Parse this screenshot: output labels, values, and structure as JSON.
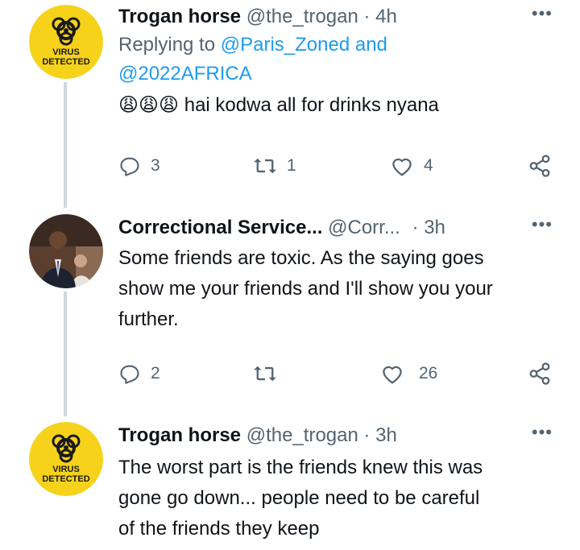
{
  "tweets": [
    {
      "author_name": "Trogan horse",
      "handle": "@the_trogan",
      "time": "4h",
      "replying_label": "Replying to",
      "replying_mentions": "@Paris_Zoned and",
      "replying_mentions2": "@2022AFRICA",
      "emoji": "😩😩😩",
      "text": "hai kodwa all for drinks nyana",
      "replies": "3",
      "retweets": "1",
      "likes": "4",
      "avatar_label_line1": "VIRUS",
      "avatar_label_line2": "DETECTED"
    },
    {
      "author_name": "Correctional Service...",
      "handle": "@Corr...",
      "time": "3h",
      "text_lines": [
        "Some friends are toxic. As the saying goes",
        "show me your friends and I'll show you your",
        "further."
      ],
      "replies": "2",
      "retweets": "",
      "likes": "26"
    },
    {
      "author_name": "Trogan horse",
      "handle": "@the_trogan",
      "time": "3h",
      "text_lines": [
        "The worst part is the friends knew this was",
        "gone go down... people need to be careful",
        "of the friends they keep"
      ],
      "avatar_label_line1": "VIRUS",
      "avatar_label_line2": "DETECTED"
    }
  ],
  "icons": {
    "more": "more-horizontal-icon",
    "reply": "reply-icon",
    "retweet": "retweet-icon",
    "like": "heart-icon",
    "share": "share-icon"
  },
  "colors": {
    "link": "#1d9bf0",
    "secondary_text": "#536471",
    "primary_text": "#0f1419",
    "thread_line": "#cfd9de",
    "virus_badge": "#f6d21a"
  }
}
